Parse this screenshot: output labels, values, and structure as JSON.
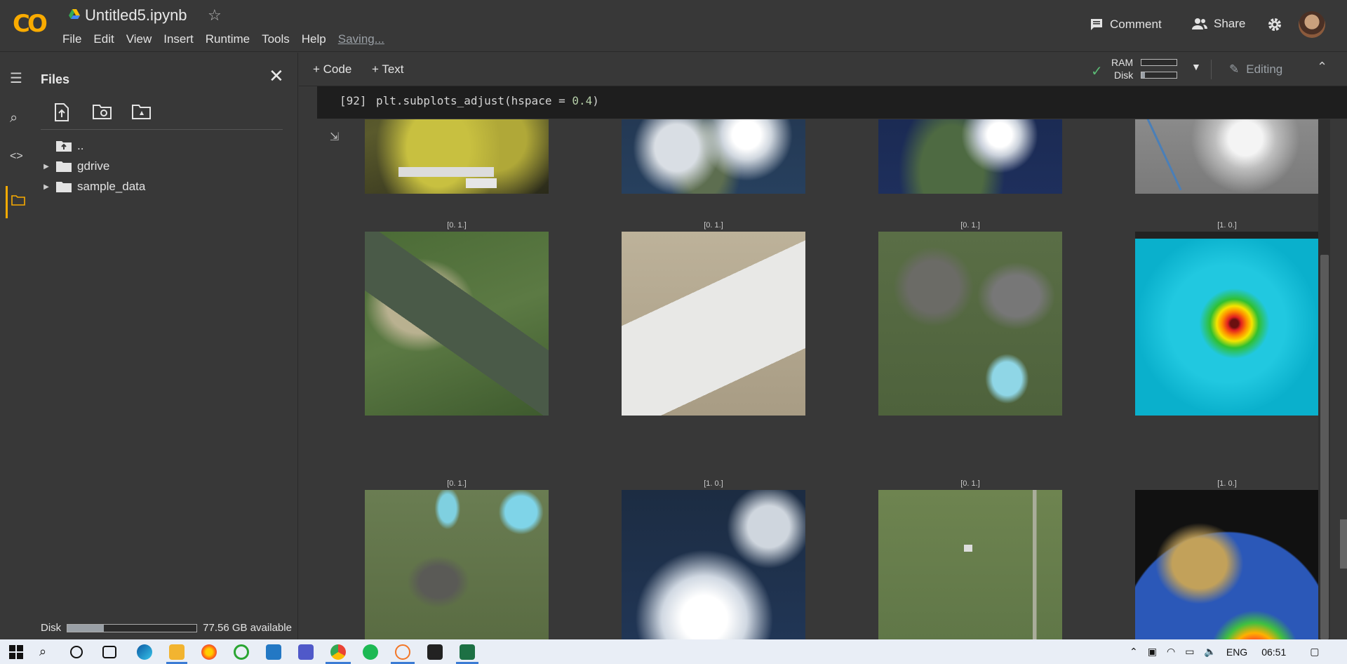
{
  "header": {
    "logo": "CO",
    "title": "Untitled5.ipynb",
    "menu": [
      "File",
      "Edit",
      "View",
      "Insert",
      "Runtime",
      "Tools",
      "Help"
    ],
    "saving": "Saving...",
    "comment_label": "Comment",
    "share_label": "Share"
  },
  "toolbar": {
    "code_label": "Code",
    "text_label": "Text",
    "ram_label": "RAM",
    "disk_label": "Disk",
    "ram_fill": 0.0,
    "disk_fill": 0.1,
    "editing_label": "Editing"
  },
  "files": {
    "title": "Files",
    "tree": [
      {
        "name": "..",
        "type": "up"
      },
      {
        "name": "gdrive",
        "type": "folder"
      },
      {
        "name": "sample_data",
        "type": "folder"
      }
    ],
    "disk_label": "Disk",
    "disk_available": "77.56 GB available",
    "disk_fill": 0.28
  },
  "cell": {
    "number": "[92]",
    "code_prefix": "plt.subplots_adjust(hspace = ",
    "code_number": "0.4",
    "code_suffix": ")"
  },
  "grid": {
    "row1_labels": [
      "",
      "",
      "",
      ""
    ],
    "row2_labels": [
      "[0. 1.]",
      "[0. 1.]",
      "[0. 1.]",
      "[1. 0.]"
    ],
    "row3_labels": [
      "[0. 1.]",
      "[1. 0.]",
      "[0. 1.]",
      "[1. 0.]"
    ]
  },
  "taskbar": {
    "lang": "ENG",
    "time": "06:51"
  }
}
